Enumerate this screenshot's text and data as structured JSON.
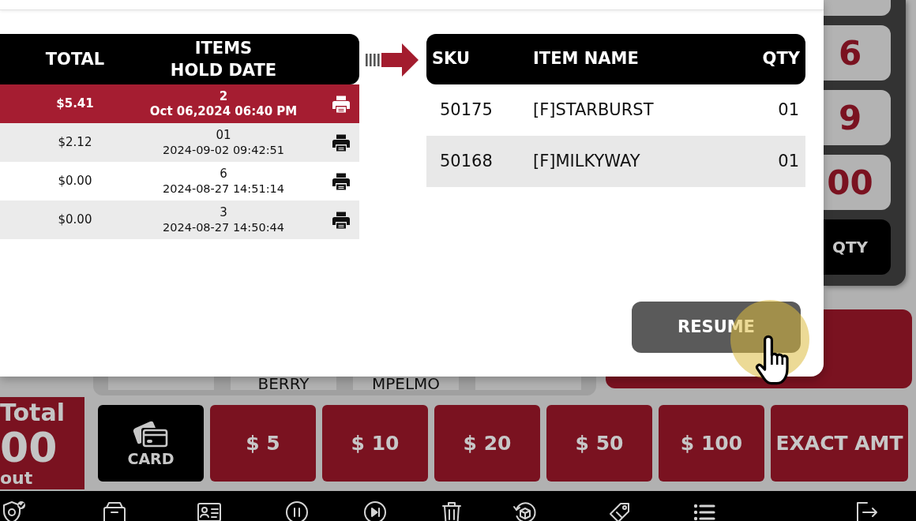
{
  "held_orders": {
    "columns": [
      {
        "lines": [
          "TOTAL"
        ]
      },
      {
        "lines": [
          "ITEMS",
          "HOLD DATE"
        ]
      }
    ],
    "rows": [
      {
        "total": "$5.41",
        "items": "2",
        "hold_date": "Oct 06,2024 06:40 PM",
        "selected": true
      },
      {
        "total": "$2.12",
        "items": "01",
        "hold_date": "2024-09-02 09:42:51",
        "selected": false
      },
      {
        "total": "$0.00",
        "items": "6",
        "hold_date": "2024-08-27 14:51:14",
        "selected": false
      },
      {
        "total": "$0.00",
        "items": "3",
        "hold_date": "2024-08-27 14:50:44",
        "selected": false
      }
    ]
  },
  "order_items": {
    "columns": [
      "SKU",
      "ITEM NAME",
      "QTY"
    ],
    "rows": [
      {
        "sku": "50175",
        "item_name": "[F]STARBURST",
        "qty": "01"
      },
      {
        "sku": "50168",
        "item_name": "[F]MILKYWAY",
        "qty": "01"
      }
    ]
  },
  "resume_button": {
    "label": "RESUME"
  },
  "keypad": [
    {
      "kind": "digit"
    },
    {
      "kind": "digit",
      "label": "6"
    },
    {
      "kind": "digit",
      "label": "9"
    },
    {
      "kind": "digit",
      "label": "00"
    },
    {
      "kind": "function",
      "label": "QTY"
    }
  ],
  "product_tiles": [
    {
      "kind": "product"
    },
    {
      "kind": "product",
      "label": "BERRY"
    },
    {
      "kind": "product",
      "label": "MPELMO"
    },
    {
      "kind": "product"
    }
  ],
  "total_panel": {
    "title": "Total",
    "amount": "00",
    "note": "out"
  },
  "payment_buttons": [
    {
      "kind": "card",
      "label": "CARD"
    },
    {
      "kind": "cash",
      "label": "$ 5"
    },
    {
      "kind": "cash",
      "label": "$ 10"
    },
    {
      "kind": "cash",
      "label": "$ 20"
    },
    {
      "kind": "cash",
      "label": "$ 50"
    },
    {
      "kind": "cash",
      "label": "$ 100"
    },
    {
      "kind": "cash",
      "label": "EXACT AMT"
    }
  ]
}
